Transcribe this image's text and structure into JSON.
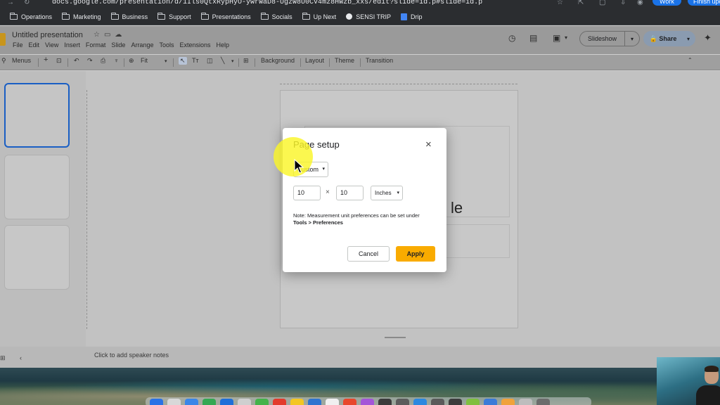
{
  "browser": {
    "url": "docs.google.com/presentation/d/1Ils0QtxRypHyO-ywrWaD8-UgzW8U0CV4mz8HWzb_xxs/edit?slide=id.p#slide=id.p",
    "profile_label": "Work",
    "finish_label": "Finish update"
  },
  "bookmarks": [
    {
      "label": "Operations",
      "icon": "folder-icon"
    },
    {
      "label": "Marketing",
      "icon": "folder-icon"
    },
    {
      "label": "Business",
      "icon": "folder-icon"
    },
    {
      "label": "Support",
      "icon": "folder-icon"
    },
    {
      "label": "Presentations",
      "icon": "folder-icon"
    },
    {
      "label": "Socials",
      "icon": "folder-icon"
    },
    {
      "label": "Up Next",
      "icon": "folder-icon"
    },
    {
      "label": "SENSI TRIP",
      "icon": "bookmark-dot-icon"
    },
    {
      "label": "Drip",
      "icon": "doc-icon"
    }
  ],
  "app": {
    "title": "Untitled presentation",
    "menu": [
      "File",
      "Edit",
      "View",
      "Insert",
      "Format",
      "Slide",
      "Arrange",
      "Tools",
      "Extensions",
      "Help"
    ],
    "slideshow_label": "Slideshow",
    "share_label": "Share"
  },
  "toolbar": {
    "menus_label": "Menus",
    "zoom_label": "Fit",
    "background_label": "Background",
    "layout_label": "Layout",
    "theme_label": "Theme",
    "transition_label": "Transition"
  },
  "editor": {
    "ghost_text": "le",
    "notes_placeholder": "Click to add speaker notes"
  },
  "dialog": {
    "title": "Page setup",
    "preset_value": "Custom",
    "width_value": "10",
    "height_value": "10",
    "times_symbol": "×",
    "unit_value": "Inches",
    "note_text": "Note: Measurement unit preferences can be set under",
    "note_path": "Tools > Preferences",
    "cancel_label": "Cancel",
    "apply_label": "Apply",
    "close_glyph": "×"
  },
  "colors": {
    "apply": "#f9ab00",
    "highlight": "#faf528",
    "active_thumb": "#1a5fc4",
    "share": "#8a9bb0"
  },
  "dock_apps": [
    "#2a72e6",
    "#d8d8d8",
    "#3a86e8",
    "#34a853",
    "#1e6fd9",
    "#cfcfcf",
    "#44b34a",
    "#e33a2c",
    "#f3c623",
    "#2f74d0",
    "#f0f0f0",
    "#e8472c",
    "#a455d8",
    "#3c3c3c",
    "#5c5c5c",
    "#2c88e0",
    "#5a5a5a",
    "#3d3d3d",
    "#7fbf3f",
    "#3b7bd8",
    "#f0a23a",
    "#bdbdbd",
    "#6c6c6c"
  ]
}
